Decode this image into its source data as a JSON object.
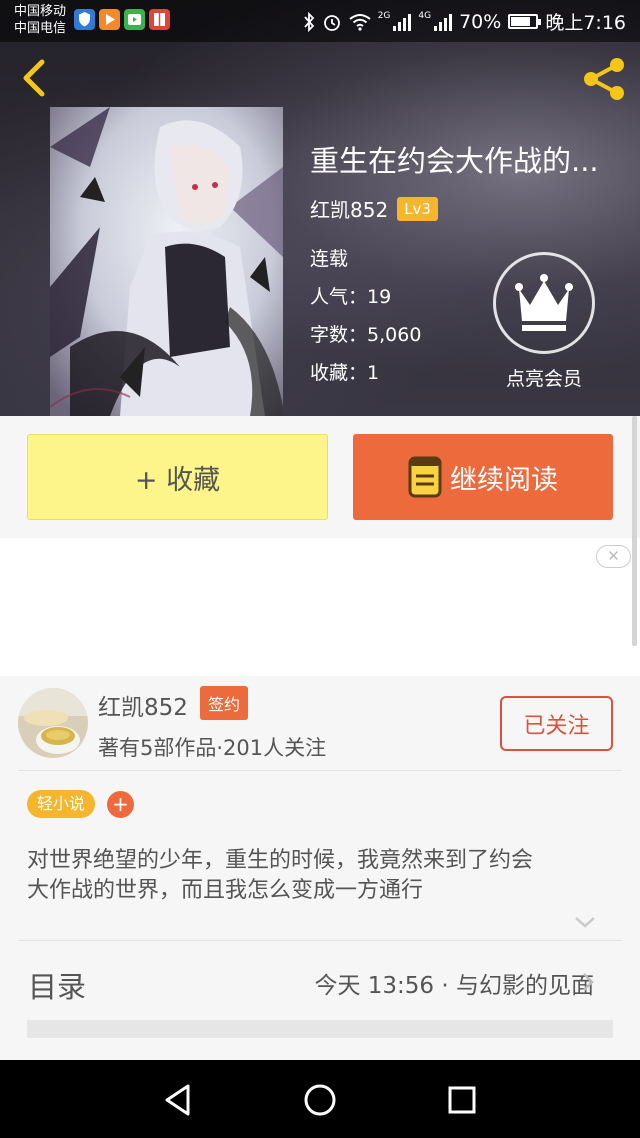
{
  "status_bar": {
    "carrier_1": "中国移动",
    "carrier_2": "中国电信",
    "net_1": "2G",
    "net_2": "4G",
    "battery": "70%",
    "time": "晚上7:16",
    "app_icons": [
      "shield-app-icon",
      "play-app-icon",
      "video-app-icon",
      "book-app-icon"
    ]
  },
  "header": {
    "back_icon": "chevron-left-icon",
    "share_icon": "share-icon",
    "accent_color": "#f5c518"
  },
  "book": {
    "title": "重生在约会大作战的...",
    "author": "红凯852",
    "level": "Lv3",
    "status": "连载",
    "popularity_label": "人气：",
    "popularity": "19",
    "word_count_label": "字数：",
    "word_count": "5,060",
    "favorites_label": "收藏：",
    "favorites": "1"
  },
  "vip": {
    "icon": "crown-icon",
    "label": "点亮会员"
  },
  "actions": {
    "collect_label": "+ 收藏",
    "read_label": "继续阅读",
    "read_icon": "book-icon",
    "collect_color": "#fdf58a",
    "read_color": "#ec6a3c"
  },
  "ad": {
    "close_label": "✕"
  },
  "author_card": {
    "name": "红凯852",
    "badge": "签约",
    "stats": "著有5部作品·201人关注",
    "follow_label": "已关注"
  },
  "tags": {
    "genre": "轻小说",
    "add_label": "+"
  },
  "synopsis": {
    "line_1": "对世界绝望的少年，重生的时候，我竟然来到了约会",
    "line_2": "大作战的世界，而且我怎么变成一方通行"
  },
  "toc": {
    "label": "目录",
    "latest": "今天 13:56 · 与幻影的见面"
  },
  "nav_bar": {
    "icons": [
      "back-triangle-icon",
      "home-circle-icon",
      "recents-square-icon"
    ]
  }
}
